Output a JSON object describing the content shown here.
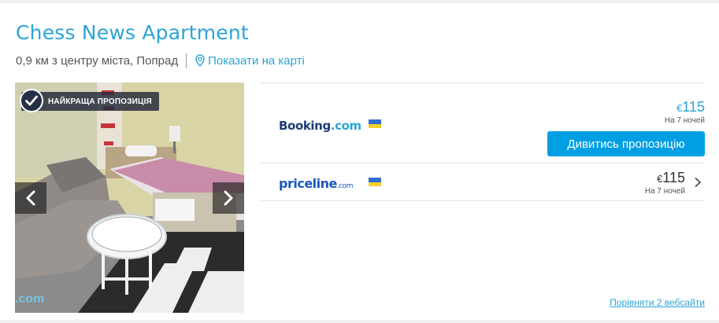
{
  "hotel": {
    "name": "Chess News Apartment",
    "location": "0,9 км з центру міста, Попрад",
    "map_link": "Показати на карті"
  },
  "photo": {
    "badge": "НАЙКРАЩА ПРОПОЗИЦІЯ",
    "watermark": ".com"
  },
  "offers": [
    {
      "provider": "Booking.com",
      "provider_main": "Booking",
      "provider_suffix": ".com",
      "currency": "€",
      "price": "115",
      "nights": "На 7 ночей",
      "cta": "Дивитись пропозицію",
      "flag_colors": [
        "#2f6fd3",
        "#f3d22e"
      ]
    },
    {
      "provider": "priceline.com",
      "provider_main": "priceline",
      "provider_suffix": ".com",
      "currency": "€",
      "price": "115",
      "nights": "На 7 ночей",
      "flag_colors": [
        "#2f6fd3",
        "#f3d22e"
      ]
    }
  ],
  "compare_link": "Порівняти 2 вебсайти",
  "colors": {
    "accent": "#2da4d6",
    "button": "#009fe3",
    "badge_bg": "#263044"
  },
  "icons": {
    "badge": "checkmark-icon",
    "map": "map-pin-icon",
    "prev": "chevron-left-icon",
    "next": "chevron-right-icon",
    "row_expand": "chevron-right-icon"
  }
}
